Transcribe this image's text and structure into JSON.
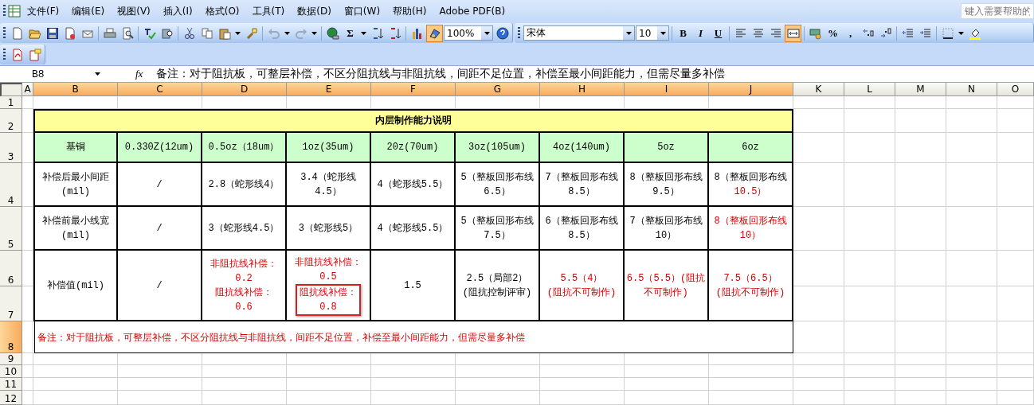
{
  "menu_bar": {
    "items": [
      "文件(F)",
      "编辑(E)",
      "视图(V)",
      "插入(I)",
      "格式(O)",
      "工具(T)",
      "数据(D)",
      "窗口(W)",
      "帮助(H)",
      "Adobe PDF(B)"
    ]
  },
  "help_box": {
    "placeholder": "键入需要帮助的"
  },
  "standard_toolbar": {
    "sum": "Σ",
    "zoom": "100%",
    "drawing_pressed": true
  },
  "formatting_toolbar": {
    "font": "宋体",
    "size": "10",
    "bold": "B",
    "italic": "I",
    "underline": "U",
    "merge_center_pressed": true,
    "percent": "%",
    "comma": ","
  },
  "formula_bar": {
    "name_box": "B8",
    "fx": "fx",
    "value": "备注：对于阻抗板，可整层补偿，不区分阻抗线与非阻抗线，间距不足位置，补偿至最小间距能力，但需尽量多补偿"
  },
  "sheet": {
    "columns": [
      {
        "label": "A",
        "selected": false
      },
      {
        "label": "B",
        "selected": true
      },
      {
        "label": "C",
        "selected": true
      },
      {
        "label": "D",
        "selected": true
      },
      {
        "label": "E",
        "selected": true
      },
      {
        "label": "F",
        "selected": true
      },
      {
        "label": "G",
        "selected": true
      },
      {
        "label": "H",
        "selected": true
      },
      {
        "label": "I",
        "selected": true
      },
      {
        "label": "J",
        "selected": true
      },
      {
        "label": "K",
        "selected": false
      },
      {
        "label": "L",
        "selected": false
      },
      {
        "label": "M",
        "selected": false
      },
      {
        "label": "N",
        "selected": false
      },
      {
        "label": "O",
        "selected": false
      }
    ],
    "rows": [
      {
        "label": "1",
        "selected": false
      },
      {
        "label": "2",
        "selected": false
      },
      {
        "label": "3",
        "selected": false
      },
      {
        "label": "4",
        "selected": false
      },
      {
        "label": "5",
        "selected": false
      },
      {
        "label": "6",
        "selected": false
      },
      {
        "label": "7",
        "selected": false
      },
      {
        "label": "8",
        "selected": true
      },
      {
        "label": "9",
        "selected": false
      },
      {
        "label": "10",
        "selected": false
      },
      {
        "label": "11",
        "selected": false
      },
      {
        "label": "12",
        "selected": false
      }
    ],
    "table": {
      "title": "内层制作能力说明",
      "header": [
        "基铜",
        "0.330Z(12um)",
        "0.5oz（18um）",
        "1oz(35um)",
        "20z(70um)",
        "3oz(105um)",
        "4oz(140um)",
        "5oz",
        "6oz"
      ],
      "rows": [
        {
          "cells": [
            {
              "lines": [
                {
                  "text": "补偿后最小间距",
                  "warning": false
                },
                {
                  "text": "(mil)",
                  "warning": false
                }
              ]
            },
            {
              "lines": [
                {
                  "text": "/",
                  "warning": false
                }
              ]
            },
            {
              "lines": [
                {
                  "text": "2.8（蛇形线4）",
                  "warning": false
                }
              ]
            },
            {
              "lines": [
                {
                  "text": "3.4（蛇形线",
                  "warning": false
                },
                {
                  "text": "4.5）",
                  "warning": false
                }
              ]
            },
            {
              "lines": [
                {
                  "text": "4（蛇形线5.5）",
                  "warning": false
                }
              ]
            },
            {
              "lines": [
                {
                  "text": "5（整板回形布线",
                  "warning": false
                },
                {
                  "text": "6.5）",
                  "warning": false
                }
              ]
            },
            {
              "lines": [
                {
                  "text": "7（整板回形布线",
                  "warning": false
                },
                {
                  "text": "8.5）",
                  "warning": false
                }
              ]
            },
            {
              "lines": [
                {
                  "text": "8（整板回形布线",
                  "warning": false
                },
                {
                  "text": "9.5）",
                  "warning": false
                }
              ]
            },
            {
              "lines": [
                {
                  "text": "8（整板回形布线",
                  "warning": false
                },
                {
                  "text": "10.5）",
                  "warning": true
                }
              ]
            }
          ]
        },
        {
          "cells": [
            {
              "lines": [
                {
                  "text": "补偿前最小线宽",
                  "warning": false
                },
                {
                  "text": "(mil)",
                  "warning": false
                }
              ]
            },
            {
              "lines": [
                {
                  "text": "/",
                  "warning": false
                }
              ]
            },
            {
              "lines": [
                {
                  "text": "3（蛇形线4.5）",
                  "warning": false
                }
              ]
            },
            {
              "lines": [
                {
                  "text": "3（蛇形线5）",
                  "warning": false
                }
              ]
            },
            {
              "lines": [
                {
                  "text": "4（蛇形线5.5）",
                  "warning": false
                }
              ]
            },
            {
              "lines": [
                {
                  "text": "5（整板回形布线",
                  "warning": false
                },
                {
                  "text": "7.5）",
                  "warning": false
                }
              ]
            },
            {
              "lines": [
                {
                  "text": "6（整板回形布线",
                  "warning": false
                },
                {
                  "text": "8.5）",
                  "warning": false
                }
              ]
            },
            {
              "lines": [
                {
                  "text": "7（整板回形布线",
                  "warning": false
                },
                {
                  "text": "10）",
                  "warning": false
                }
              ]
            },
            {
              "lines": [
                {
                  "text": "8（整板回形布线",
                  "warning": true
                },
                {
                  "text": "10）",
                  "warning": true
                }
              ]
            }
          ]
        },
        {
          "cells": [
            {
              "lines": [
                {
                  "text": "补偿值(mil)",
                  "warning": false
                }
              ]
            },
            {
              "lines": [
                {
                  "text": "/",
                  "warning": false
                }
              ]
            },
            {
              "lines": [
                {
                  "text": "非阻抗线补偿：",
                  "warning": true
                },
                {
                  "text": "0.2",
                  "warning": true
                },
                {
                  "text": "阻抗线补偿：",
                  "warning": true
                },
                {
                  "text": "0.6",
                  "warning": true
                }
              ]
            },
            {
              "lines": [
                {
                  "text": "非阻抗线补偿：",
                  "warning": true
                },
                {
                  "text": "0.5",
                  "warning": true
                }
              ],
              "callout": {
                "lines": [
                  {
                    "text": "阻抗线补偿：",
                    "warning": true
                  },
                  {
                    "text": "0.8",
                    "warning": true
                  }
                ]
              }
            },
            {
              "lines": [
                {
                  "text": "1.5",
                  "warning": false
                }
              ]
            },
            {
              "lines": [
                {
                  "text": "2.5（局部2）",
                  "warning": false
                },
                {
                  "text": "(阻抗控制评审)",
                  "warning": false
                }
              ]
            },
            {
              "lines": [
                {
                  "text": "5.5（4）",
                  "warning": true
                },
                {
                  "text": "(阻抗不可制作)",
                  "warning": true
                }
              ]
            },
            {
              "lines": [
                {
                  "text": "6.5（5.5）(阻抗",
                  "warning": true
                },
                {
                  "text": "不可制作)",
                  "warning": true
                }
              ]
            },
            {
              "lines": [
                {
                  "text": "7.5（6.5）",
                  "warning": true
                },
                {
                  "text": "(阻抗不可制作)",
                  "warning": true
                }
              ]
            }
          ]
        }
      ],
      "note": {
        "text": "备注：对于阻抗板，可整层补偿，不区分阻抗线与非阻抗线，间距不足位置，补偿至最小间距能力，但需尽量多补偿",
        "warning": true
      }
    }
  }
}
